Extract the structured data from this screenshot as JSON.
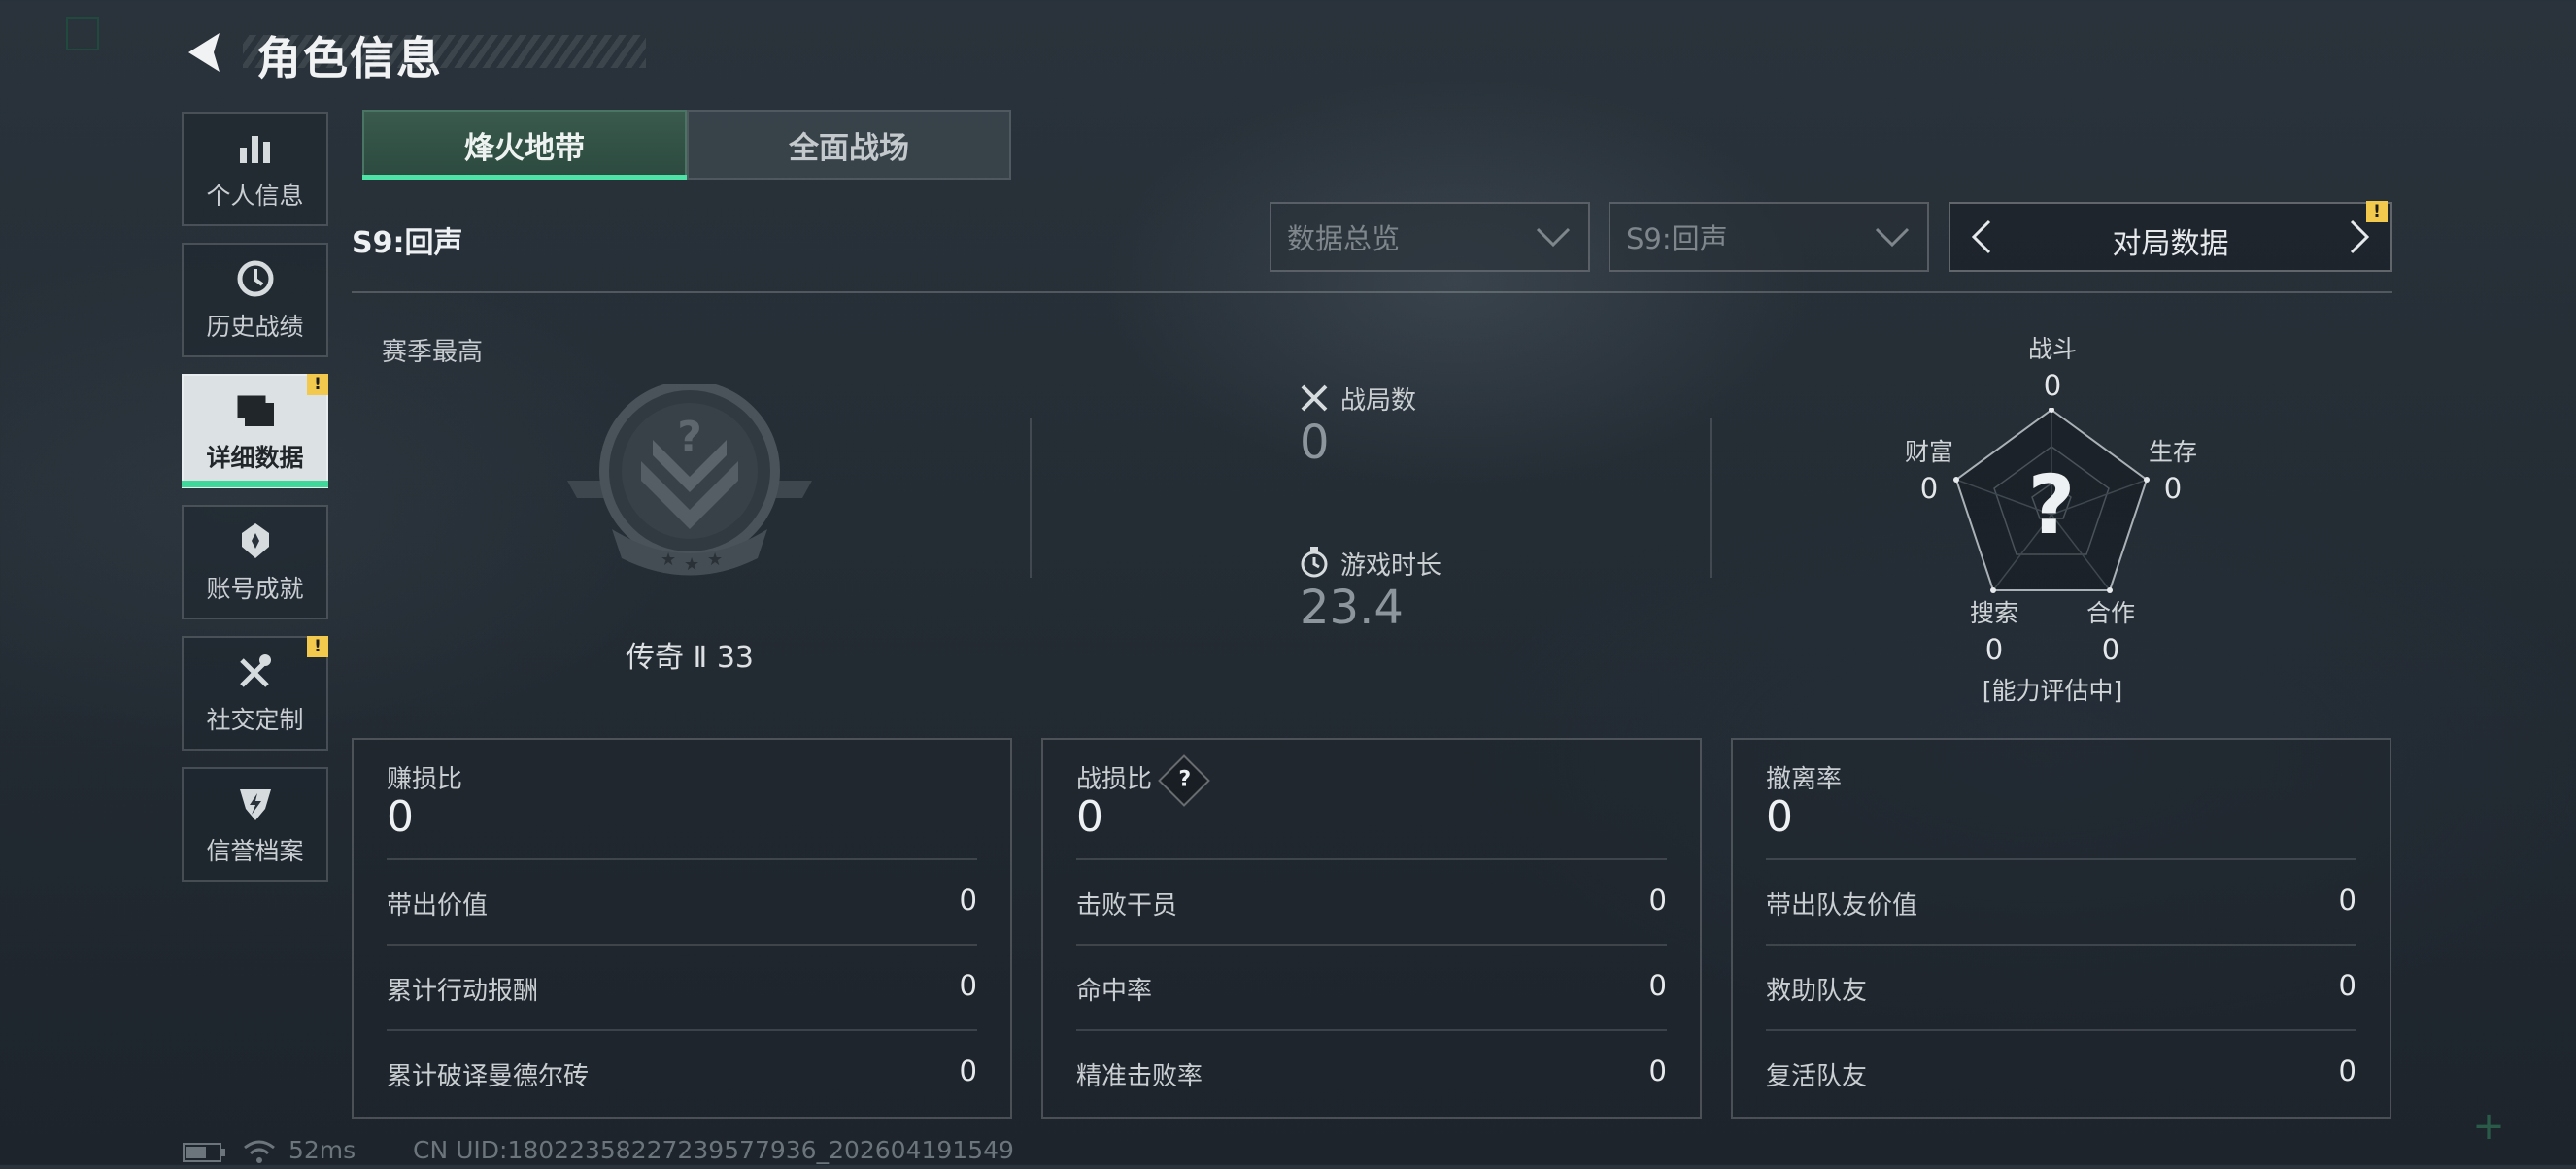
{
  "header": {
    "title": "角色信息"
  },
  "sidebar": {
    "items": [
      {
        "label": "个人信息",
        "icon": "bar-chart-icon"
      },
      {
        "label": "历史战绩",
        "icon": "history-clock-icon"
      },
      {
        "label": "详细数据",
        "icon": "folder-data-icon",
        "active": true,
        "alert": "!"
      },
      {
        "label": "账号成就",
        "icon": "medal-icon"
      },
      {
        "label": "社交定制",
        "icon": "tools-icon",
        "alert": "!"
      },
      {
        "label": "信誉档案",
        "icon": "shield-lightning-icon"
      }
    ]
  },
  "tabs": [
    {
      "label": "烽火地带",
      "active": true
    },
    {
      "label": "全面战场",
      "active": false
    }
  ],
  "filters": {
    "season_label": "S9:回声",
    "dropdown_overview": "数据总览",
    "dropdown_season": "S9:回声",
    "pager_label": "对局数据",
    "pager_alert": "!"
  },
  "highest": {
    "label": "赛季最高",
    "rank_text": "传奇 Ⅱ 33",
    "badge_glyph": "?"
  },
  "summary": {
    "matches_label": "战局数",
    "matches_value": "0",
    "playtime_label": "游戏时长",
    "playtime_value": "23.4"
  },
  "radar": {
    "center_glyph": "?",
    "axes": [
      {
        "label": "战斗",
        "value": "0"
      },
      {
        "label": "生存",
        "value": "0"
      },
      {
        "label": "合作",
        "value": "0"
      },
      {
        "label": "搜索",
        "value": "0"
      },
      {
        "label": "财富",
        "value": "0"
      }
    ],
    "status": "[能力评估中]"
  },
  "cards": [
    {
      "title": "赚损比",
      "value": "0",
      "rows": [
        {
          "label": "带出价值",
          "value": "0"
        },
        {
          "label": "累计行动报酬",
          "value": "0"
        },
        {
          "label": "累计破译曼德尔砖",
          "value": "0"
        }
      ]
    },
    {
      "title": "战损比",
      "value": "0",
      "help": "?",
      "rows": [
        {
          "label": "击败干员",
          "value": "0"
        },
        {
          "label": "命中率",
          "value": "0"
        },
        {
          "label": "精准击败率",
          "value": "0"
        }
      ]
    },
    {
      "title": "撤离率",
      "value": "0",
      "rows": [
        {
          "label": "带出队友价值",
          "value": "0"
        },
        {
          "label": "救助队友",
          "value": "0"
        },
        {
          "label": "复活队友",
          "value": "0"
        }
      ]
    }
  ],
  "status_bar": {
    "ping": "52ms",
    "uid": "CN UID:18022358227239577936_202604191549"
  },
  "colors": {
    "accent": "#3ed99a",
    "alert": "#f2c94c"
  }
}
